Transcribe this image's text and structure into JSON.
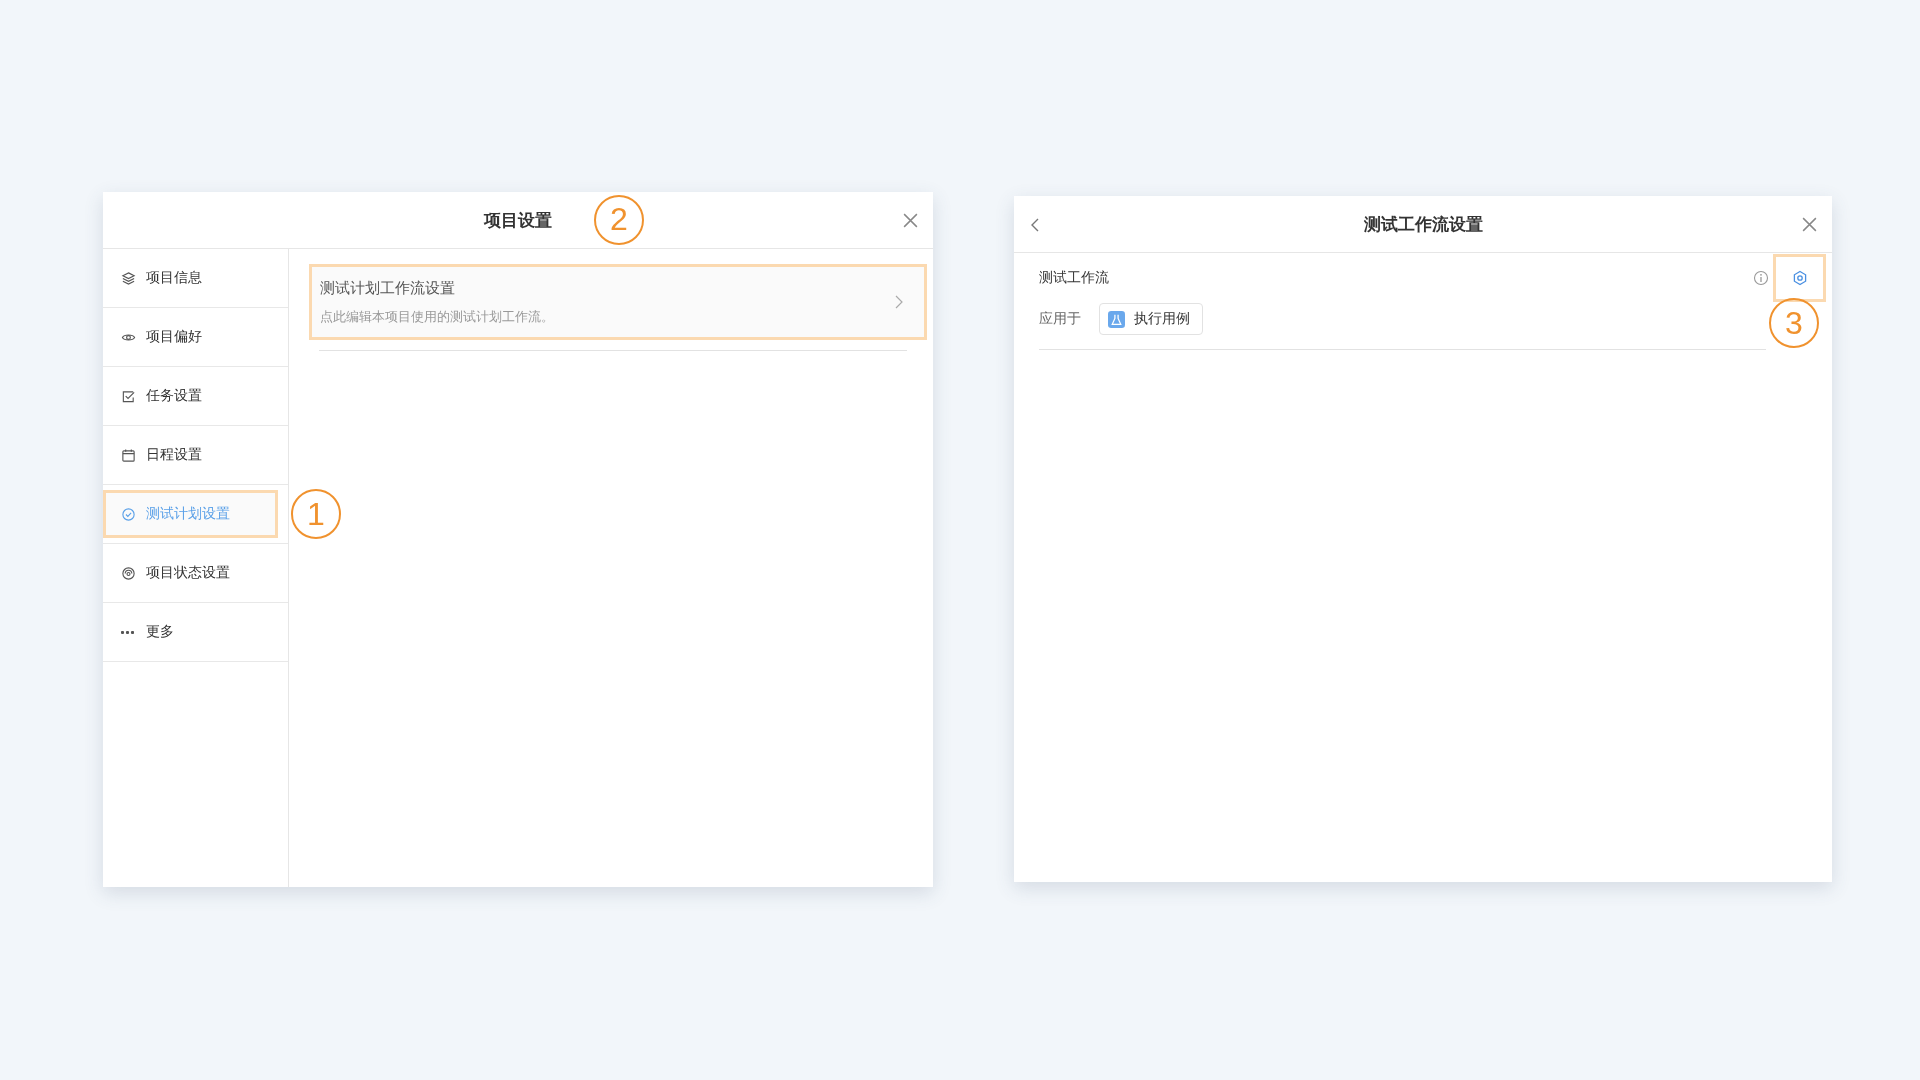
{
  "project_settings": {
    "title": "项目设置",
    "callout": "2",
    "sidebar": {
      "items": [
        {
          "label": "项目信息",
          "selected": false,
          "highlighted": false
        },
        {
          "label": "项目偏好",
          "selected": false,
          "highlighted": false
        },
        {
          "label": "任务设置",
          "selected": false,
          "highlighted": false
        },
        {
          "label": "日程设置",
          "selected": false,
          "highlighted": false
        },
        {
          "label": "测试计划设置",
          "selected": true,
          "highlighted": true,
          "callout": "1"
        },
        {
          "label": "项目状态设置",
          "selected": false,
          "highlighted": false
        },
        {
          "label": "更多",
          "selected": false,
          "highlighted": false
        }
      ]
    },
    "card": {
      "title": "测试计划工作流设置",
      "description": "点此编辑本项目使用的测试计划工作流。",
      "highlighted": true
    }
  },
  "workflow_settings": {
    "title": "测试工作流设置",
    "workflow": {
      "name": "测试工作流",
      "applies_label": "应用于",
      "applies_tag": "执行用例"
    },
    "gear": {
      "highlighted": true,
      "callout": "3"
    }
  }
}
